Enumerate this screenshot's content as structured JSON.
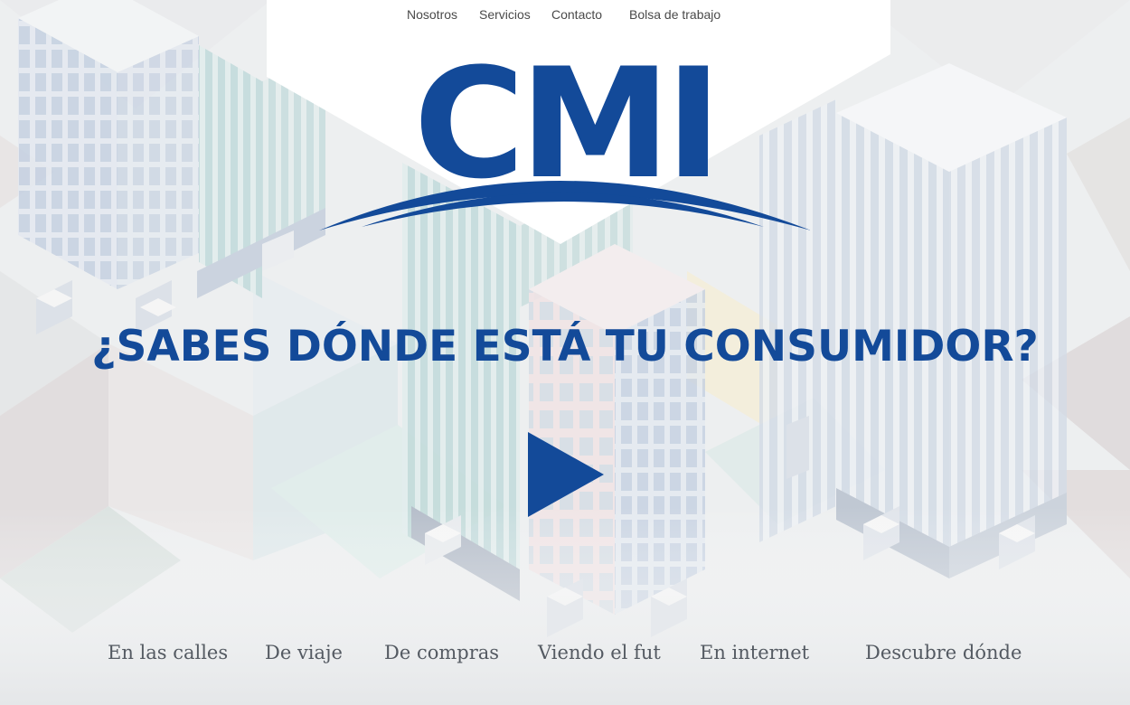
{
  "top_nav": {
    "items": [
      {
        "label": "Nosotros"
      },
      {
        "label": "Servicios"
      },
      {
        "label": "Contacto"
      },
      {
        "label": "Bolsa de trabajo"
      }
    ]
  },
  "logo": {
    "text": "CMI",
    "color": "#134a99"
  },
  "hero": {
    "headline": "¿SABES DÓNDE ESTÁ TU CONSUMIDOR?",
    "play_icon": "play-icon"
  },
  "bottom_nav": {
    "items": [
      {
        "label": "En las calles"
      },
      {
        "label": "De viaje"
      },
      {
        "label": "De compras"
      },
      {
        "label": "Viendo el fut"
      },
      {
        "label": "En internet"
      },
      {
        "label": "Descubre dónde"
      }
    ]
  },
  "colors": {
    "brand_blue": "#134a99",
    "nav_text": "#4a4a4a",
    "bottom_text": "#545a62"
  }
}
